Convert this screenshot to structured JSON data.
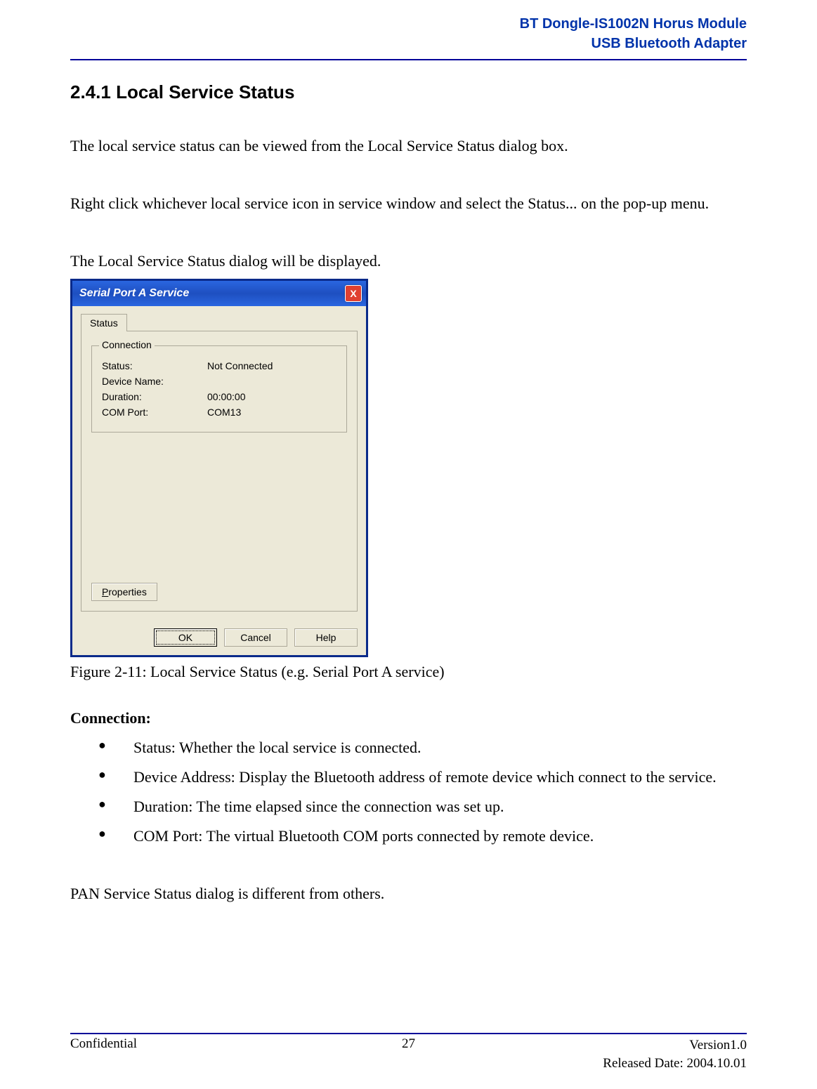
{
  "header": {
    "line1": "BT Dongle-IS1002N Horus Module",
    "line2": "USB Bluetooth Adapter"
  },
  "section": {
    "number": "2.4.1",
    "title": "Local Service Status"
  },
  "paragraphs": {
    "p1": "The local service status can be viewed from the Local Service Status dialog box.",
    "p2": "Right click whichever local service icon in service window and select the Status... on the pop-up menu.",
    "p3": "The Local Service Status dialog will be displayed.",
    "caption": "Figure 2-11: Local Service Status (e.g. Serial Port A service)",
    "connection_label": "Connection:",
    "p4": "PAN Service Status dialog is different from others."
  },
  "bullets": [
    "Status: Whether the local service is connected.",
    "Device Address: Display the Bluetooth address of remote device which connect to the service.",
    "Duration: The time elapsed since the connection was set up.",
    "COM Port: The virtual Bluetooth COM ports connected by remote device."
  ],
  "dialog": {
    "title": "Serial Port A Service",
    "close": "X",
    "tab": "Status",
    "groupbox": "Connection",
    "rows": {
      "status_label": "Status:",
      "status_value": "Not Connected",
      "device_label": "Device Name:",
      "device_value": "",
      "duration_label": "Duration:",
      "duration_value": "00:00:00",
      "comport_label": "COM Port:",
      "comport_value": "COM13"
    },
    "properties_prefix": "P",
    "properties_rest": "roperties",
    "ok": "OK",
    "cancel": "Cancel",
    "help": "Help"
  },
  "footer": {
    "left": "Confidential",
    "center": "27",
    "right1": "Version1.0",
    "right2": "Released Date: 2004.10.01"
  }
}
